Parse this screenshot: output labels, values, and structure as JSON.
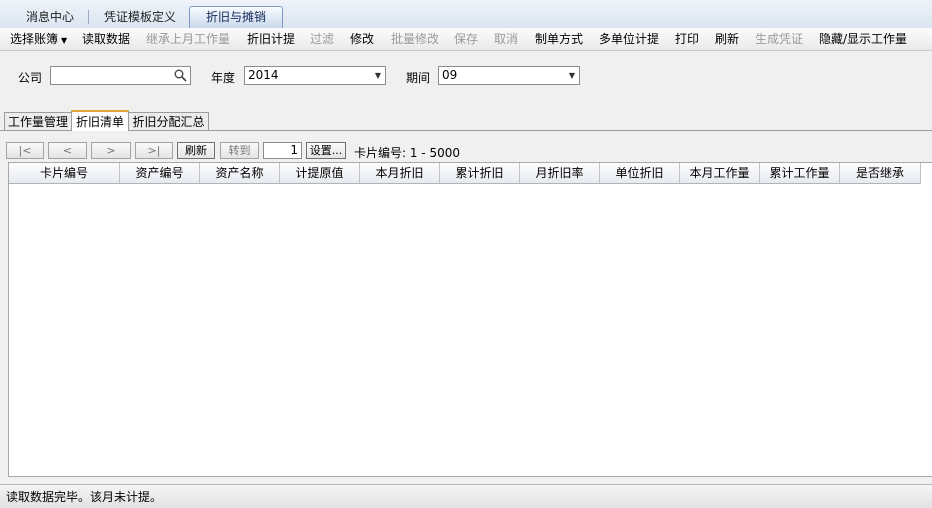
{
  "top_tabs": [
    "消息中心",
    "凭证模板定义",
    "折旧与摊销"
  ],
  "toolbar": [
    {
      "label": "选择账簿",
      "disabled": false,
      "dropdown": true
    },
    {
      "label": "读取数据",
      "disabled": false
    },
    {
      "label": "继承上月工作量",
      "disabled": true
    },
    {
      "label": "折旧计提",
      "disabled": false
    },
    {
      "label": "过滤",
      "disabled": true
    },
    {
      "label": "修改",
      "disabled": false
    },
    {
      "label": "批量修改",
      "disabled": true
    },
    {
      "label": "保存",
      "disabled": true
    },
    {
      "label": "取消",
      "disabled": true
    },
    {
      "label": "制单方式",
      "disabled": false
    },
    {
      "label": "多单位计提",
      "disabled": false
    },
    {
      "label": "打印",
      "disabled": false
    },
    {
      "label": "刷新",
      "disabled": false
    },
    {
      "label": "生成凭证",
      "disabled": true
    },
    {
      "label": "隐藏/显示工作量",
      "disabled": false
    }
  ],
  "form": {
    "company_label": "公司",
    "company_value": "",
    "year_label": "年度",
    "year_value": "2014",
    "period_label": "期间",
    "period_value": "09"
  },
  "sub_tabs": [
    "工作量管理",
    "折旧清单",
    "折旧分配汇总"
  ],
  "pager": {
    "first": "|<",
    "prev": "<",
    "next": ">",
    "last": ">|",
    "refresh": "刷新",
    "goto": "转到",
    "page_value": "1",
    "settings": "设置...",
    "range_text": "卡片编号: 1 - 5000"
  },
  "columns": [
    "卡片编号",
    "资产编号",
    "资产名称",
    "计提原值",
    "本月折旧",
    "累计折旧",
    "月折旧率",
    "单位折旧",
    "本月工作量",
    "累计工作量",
    "是否继承"
  ],
  "status": "读取数据完毕。该月未计提。"
}
